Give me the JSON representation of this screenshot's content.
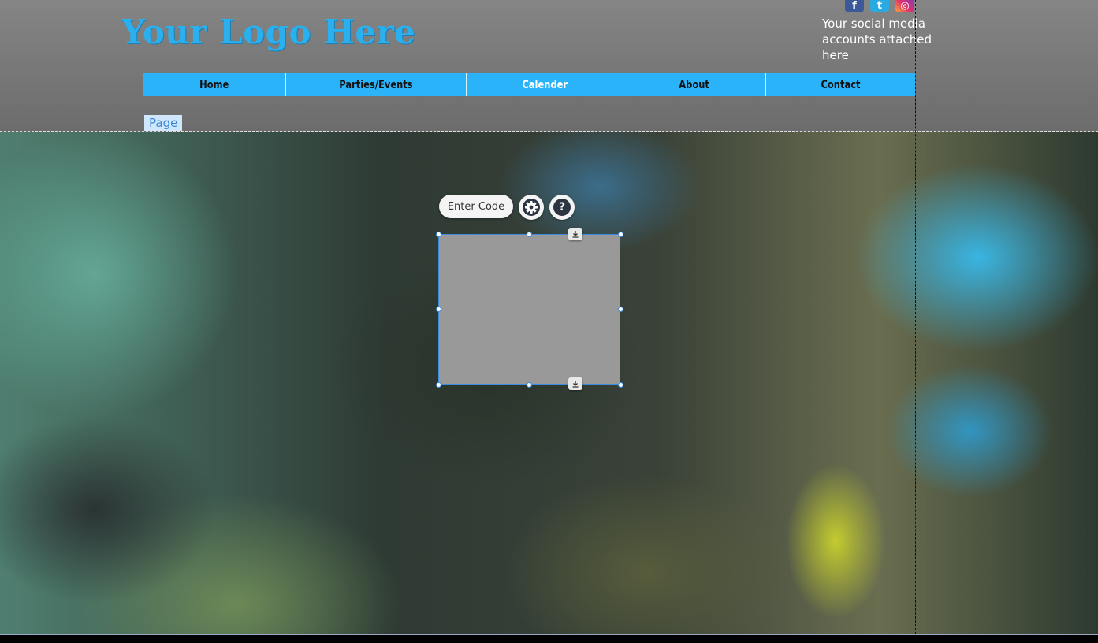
{
  "header": {
    "logo_text": "Your Logo Here",
    "social_text": "Your social media accounts attached here",
    "social_icons": [
      {
        "name": "facebook-icon",
        "glyph": "f"
      },
      {
        "name": "twitter-icon",
        "glyph": "t"
      },
      {
        "name": "instagram-icon",
        "glyph": "◎"
      }
    ]
  },
  "nav": {
    "items": [
      {
        "label": "Home",
        "active": false
      },
      {
        "label": "Parties/Events",
        "active": false
      },
      {
        "label": "Calender",
        "active": true
      },
      {
        "label": "About",
        "active": false
      },
      {
        "label": "Contact",
        "active": false
      }
    ]
  },
  "page_tag": "Page",
  "embed_toolbar": {
    "enter_code_label": "Enter Code",
    "settings_icon": "gear-icon",
    "help_icon": "help-icon",
    "help_glyph": "?"
  },
  "colors": {
    "nav_bg": "#2ab3f8",
    "logo": "#2ab0ef",
    "selection": "#3c8ce0"
  }
}
